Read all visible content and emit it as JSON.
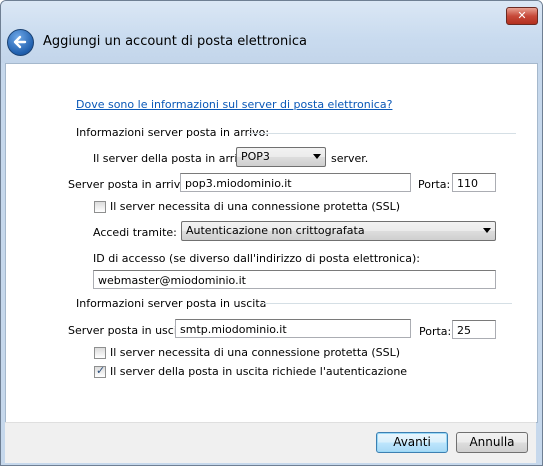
{
  "window": {
    "title": "Aggiungi un account di posta elettronica",
    "close_glyph": "✕"
  },
  "help_link": "Dove sono le informazioni sul server di posta elettronica?",
  "incoming": {
    "section_title": "Informazioni server posta in arrivo:",
    "server_type_prefix": "Il server della posta in arrivo è",
    "server_type_value": "POP3",
    "server_type_suffix": "server.",
    "server_label": "Server posta in arrivo:",
    "server_value": "pop3.miodominio.it",
    "port_label": "Porta:",
    "port_value": "110",
    "ssl_label": "Il server necessita di una connessione protetta (SSL)",
    "ssl_checked": false,
    "login_via_label": "Accedi tramite:",
    "login_via_value": "Autenticazione non crittografata",
    "login_id_label": "ID di accesso (se diverso dall'indirizzo di posta elettronica):",
    "login_id_value": "webmaster@miodominio.it"
  },
  "outgoing": {
    "section_title": "Informazioni server posta in uscita",
    "server_label": "Server posta in uscita:",
    "server_value": "smtp.miodominio.it",
    "port_label": "Porta:",
    "port_value": "25",
    "ssl_label": "Il server necessita di una connessione protetta (SSL)",
    "ssl_checked": false,
    "auth_label": "Il server della posta in uscita richiede l'autenticazione",
    "auth_checked": true
  },
  "buttons": {
    "next": "Avanti",
    "cancel": "Annulla"
  }
}
